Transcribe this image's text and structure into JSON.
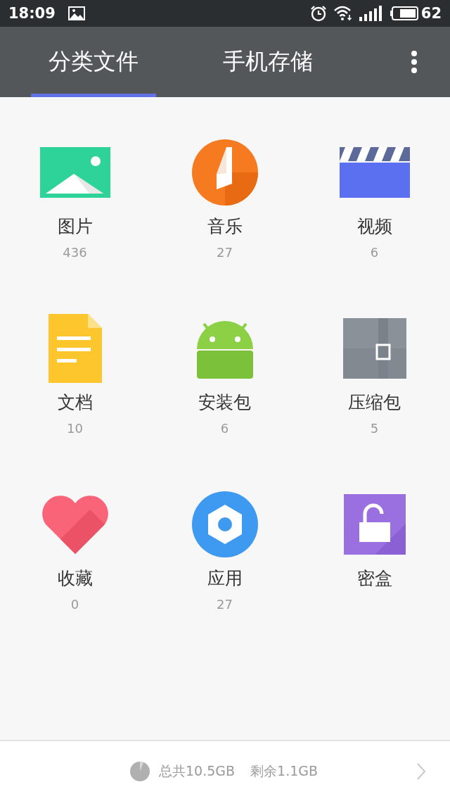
{
  "status_bar": {
    "time": "18:09",
    "battery": "62"
  },
  "tabs": [
    {
      "label": "分类文件",
      "selected": true
    },
    {
      "label": "手机存储",
      "selected": false
    }
  ],
  "categories": [
    {
      "kind": "images",
      "label": "图片",
      "count": "436"
    },
    {
      "kind": "music",
      "label": "音乐",
      "count": "27"
    },
    {
      "kind": "video",
      "label": "视频",
      "count": "6"
    },
    {
      "kind": "documents",
      "label": "文档",
      "count": "10"
    },
    {
      "kind": "apk",
      "label": "安装包",
      "count": "6"
    },
    {
      "kind": "archive",
      "label": "压缩包",
      "count": "5"
    },
    {
      "kind": "favorites",
      "label": "收藏",
      "count": "0"
    },
    {
      "kind": "apps",
      "label": "应用",
      "count": "27"
    },
    {
      "kind": "vault",
      "label": "密盒"
    }
  ],
  "storage": {
    "total": "总共10.5GB",
    "free": "剩余1.1GB"
  }
}
